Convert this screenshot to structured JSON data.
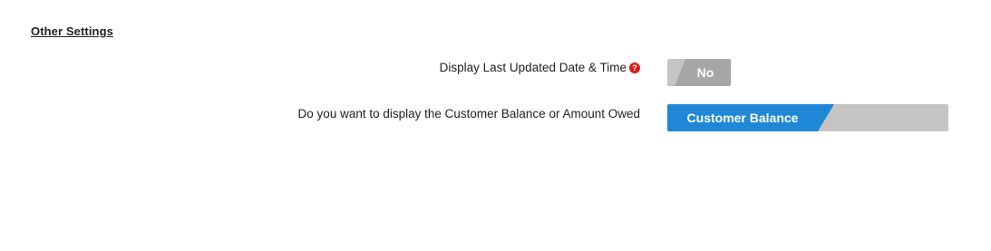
{
  "section": {
    "title": "Other Settings"
  },
  "settings": [
    {
      "label": "Display Last Updated Date & Time",
      "help_icon": "?",
      "toggle_value": "No"
    },
    {
      "label": "Do you want to display the Customer Balance or Amount Owed",
      "toggle_value": "Customer Balance"
    }
  ],
  "colors": {
    "toggle_active_blue": "#1e88d6",
    "toggle_off_gray": "#c4c4c4",
    "toggle_no_gray": "#a6a6a6",
    "help_icon_red": "#e01b1b"
  },
  "icons": {
    "help": "question-circle-icon"
  }
}
